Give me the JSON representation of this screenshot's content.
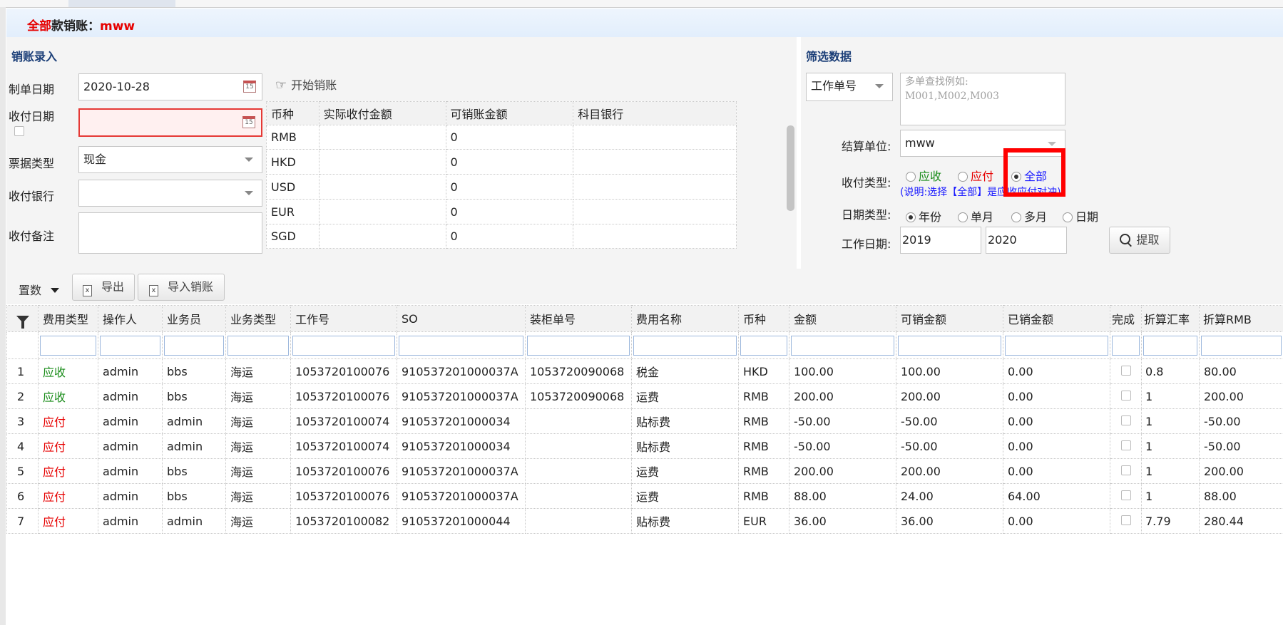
{
  "banner": {
    "prefix": "全部",
    "middle": "款销账：",
    "client": "mww"
  },
  "entry": {
    "title": "销账录入",
    "make_date_label": "制单日期",
    "make_date_value": "2020-10-28",
    "pay_date_label": "收付日期",
    "pay_date_value": "",
    "bill_type_label": "票据类型",
    "bill_type_value": "现金",
    "bank_label": "收付银行",
    "bank_value": "",
    "remark_label": "收付备注",
    "start_button": "开始销账",
    "currency_headers": [
      "币种",
      "实际收付金额",
      "可销账金额",
      "科目银行"
    ],
    "currency_rows": [
      {
        "currency": "RMB",
        "actual": "",
        "writeoff": "0",
        "bank": ""
      },
      {
        "currency": "HKD",
        "actual": "",
        "writeoff": "0",
        "bank": ""
      },
      {
        "currency": "USD",
        "actual": "",
        "writeoff": "0",
        "bank": ""
      },
      {
        "currency": "EUR",
        "actual": "",
        "writeoff": "0",
        "bank": ""
      },
      {
        "currency": "SGD",
        "actual": "",
        "writeoff": "0",
        "bank": ""
      }
    ]
  },
  "filter": {
    "title": "筛选数据",
    "field_select": "工作单号",
    "multi_placeholder": "多单查找例如:\nM001,M002,M003",
    "settle_label": "结算单位:",
    "settle_value": "mww",
    "pay_type_label": "收付类型:",
    "pay_type_options": [
      "应收",
      "应付",
      "全部"
    ],
    "pay_type_note": "(说明:选择【全部】是应收应付对冲)",
    "date_type_label": "日期类型:",
    "date_type_options": [
      "年份",
      "单月",
      "多月",
      "日期"
    ],
    "work_date_label": "工作日期:",
    "work_date_from": "2019",
    "work_date_to": "2020",
    "fetch_button": "提取"
  },
  "toolbar": {
    "reset_label": "置数",
    "export_label": "导出",
    "import_label": "导入销账"
  },
  "table": {
    "headers": [
      "费用类型",
      "操作人",
      "业务员",
      "业务类型",
      "工作号",
      "SO",
      "装柜单号",
      "费用名称",
      "币种",
      "金额",
      "可销金额",
      "已销金额",
      "完成",
      "折算汇率",
      "折算RMB"
    ],
    "rows": [
      {
        "no": "1",
        "fee_type": "应收",
        "fee_color": "green",
        "operator": "admin",
        "sales": "bbs",
        "biz": "海运",
        "job": "1053720100076",
        "so": "910537201000037A",
        "container": "1053720090068",
        "fee_name": "税金",
        "currency": "HKD",
        "amount": "100.00",
        "writeoff": "100.00",
        "written": "0.00",
        "rate": "0.8",
        "rmb": "80.00"
      },
      {
        "no": "2",
        "fee_type": "应收",
        "fee_color": "green",
        "operator": "admin",
        "sales": "bbs",
        "biz": "海运",
        "job": "1053720100076",
        "so": "910537201000037A",
        "container": "1053720090068",
        "fee_name": "运费",
        "currency": "RMB",
        "amount": "200.00",
        "writeoff": "200.00",
        "written": "0.00",
        "rate": "1",
        "rmb": "200.00"
      },
      {
        "no": "3",
        "fee_type": "应付",
        "fee_color": "red",
        "operator": "admin",
        "sales": "admin",
        "biz": "海运",
        "job": "1053720100074",
        "so": "910537201000034",
        "container": "",
        "fee_name": "贴标费",
        "currency": "RMB",
        "amount": "-50.00",
        "writeoff": "-50.00",
        "written": "0.00",
        "rate": "1",
        "rmb": "-50.00"
      },
      {
        "no": "4",
        "fee_type": "应付",
        "fee_color": "red",
        "operator": "admin",
        "sales": "admin",
        "biz": "海运",
        "job": "1053720100074",
        "so": "910537201000034",
        "container": "",
        "fee_name": "贴标费",
        "currency": "RMB",
        "amount": "-50.00",
        "writeoff": "-50.00",
        "written": "0.00",
        "rate": "1",
        "rmb": "-50.00"
      },
      {
        "no": "5",
        "fee_type": "应付",
        "fee_color": "red",
        "operator": "admin",
        "sales": "bbs",
        "biz": "海运",
        "job": "1053720100076",
        "so": "910537201000037A",
        "container": "",
        "fee_name": "运费",
        "currency": "RMB",
        "amount": "200.00",
        "writeoff": "200.00",
        "written": "0.00",
        "rate": "1",
        "rmb": "200.00"
      },
      {
        "no": "6",
        "fee_type": "应付",
        "fee_color": "red",
        "operator": "admin",
        "sales": "bbs",
        "biz": "海运",
        "job": "1053720100076",
        "so": "910537201000037A",
        "container": "",
        "fee_name": "运费",
        "currency": "RMB",
        "amount": "88.00",
        "writeoff": "24.00",
        "written": "64.00",
        "rate": "1",
        "rmb": "88.00"
      },
      {
        "no": "7",
        "fee_type": "应付",
        "fee_color": "red",
        "operator": "admin",
        "sales": "admin",
        "biz": "海运",
        "job": "1053720100082",
        "so": "910537201000044",
        "container": "",
        "fee_name": "贴标费",
        "currency": "EUR",
        "amount": "36.00",
        "writeoff": "36.00",
        "written": "0.00",
        "rate": "7.79",
        "rmb": "280.44"
      }
    ]
  }
}
